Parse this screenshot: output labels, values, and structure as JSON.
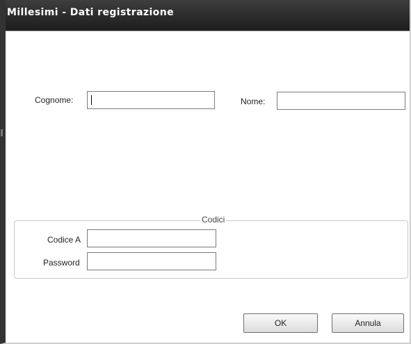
{
  "window": {
    "title": "Millesimi - Dati registrazione"
  },
  "form": {
    "cognome_label": "Cognome:",
    "cognome_value": "",
    "nome_label": "Nome:",
    "nome_value": ""
  },
  "codici": {
    "legend": "Codici",
    "codice_a_label": "Codice A",
    "codice_a_value": "",
    "password_label": "Password",
    "password_value": ""
  },
  "buttons": {
    "ok_label": "OK",
    "cancel_label": "Annula"
  }
}
